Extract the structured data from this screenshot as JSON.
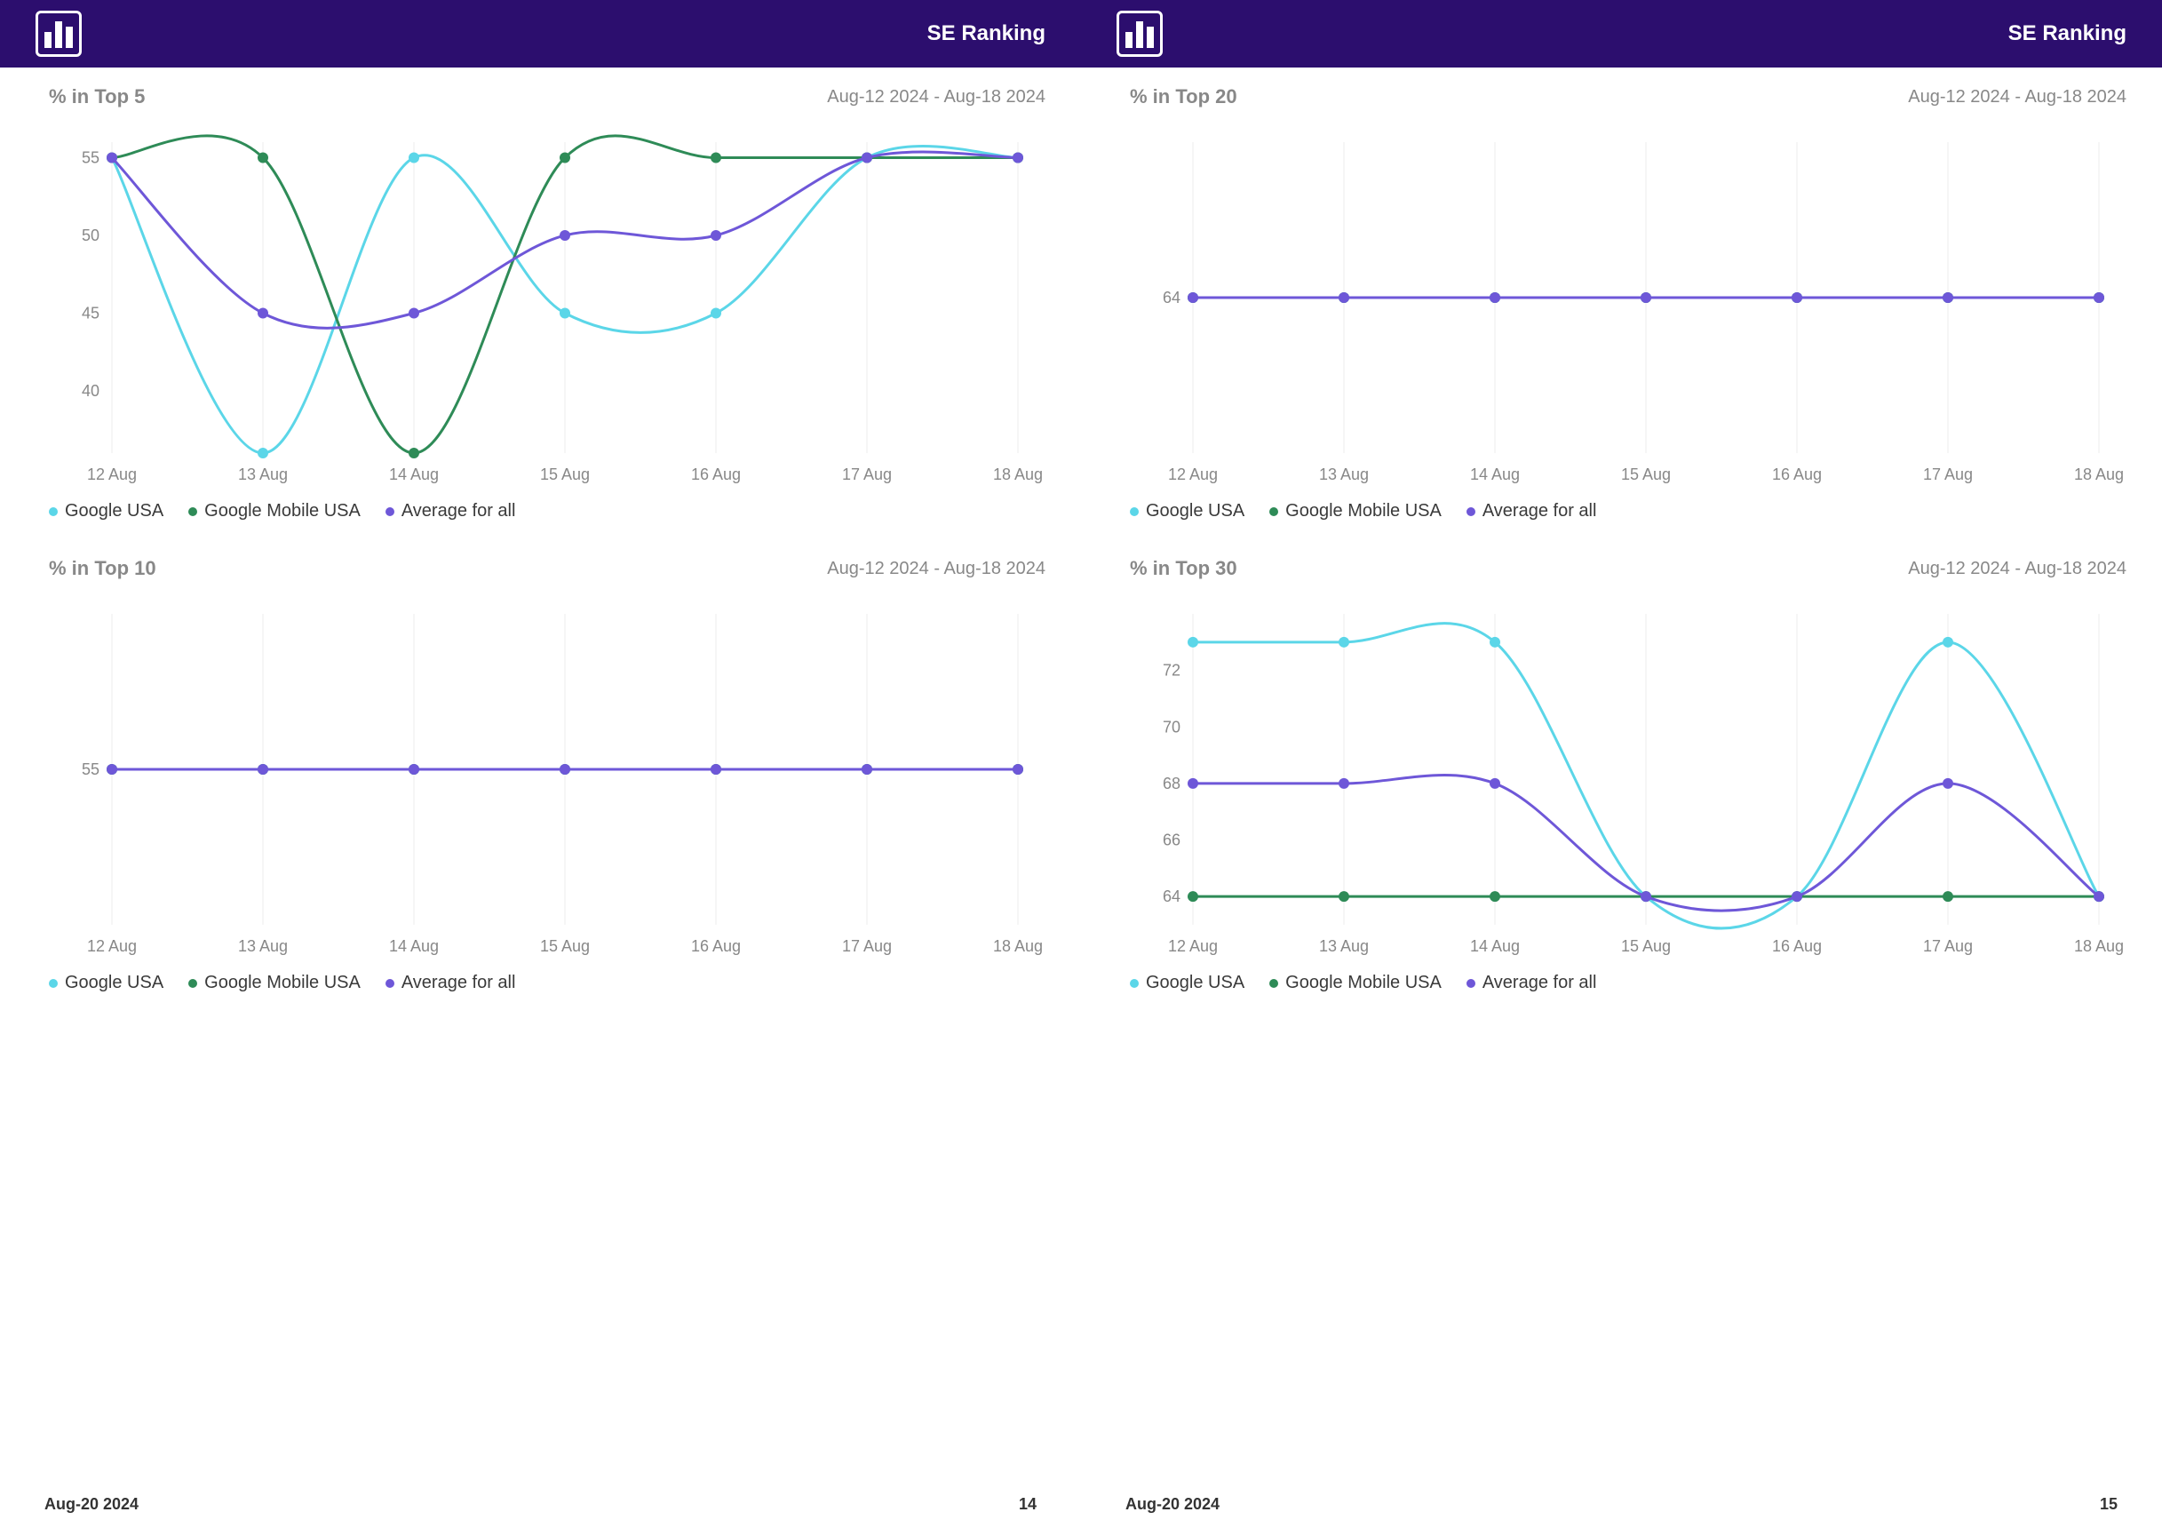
{
  "brand": "SE Ranking",
  "date_range": "Aug-12 2024 - Aug-18 2024",
  "footer_date": "Aug-20 2024",
  "page_left": "14",
  "page_right": "15",
  "categories": [
    "12 Aug",
    "13 Aug",
    "14 Aug",
    "15 Aug",
    "16 Aug",
    "17 Aug",
    "18 Aug"
  ],
  "legends": [
    {
      "name": "Google USA",
      "color": "#5bd6e8"
    },
    {
      "name": "Google Mobile USA",
      "color": "#2e8b57"
    },
    {
      "name": "Average for all",
      "color": "#6e57d8"
    }
  ],
  "chart_data": [
    {
      "id": "top5",
      "title": "% in Top 5",
      "type": "line",
      "ylim": [
        36,
        56
      ],
      "yticks": [
        40,
        45,
        50,
        55
      ],
      "series": [
        {
          "name": "Google USA",
          "color": "#5bd6e8",
          "values": [
            55,
            36,
            55,
            45,
            45,
            55,
            55
          ]
        },
        {
          "name": "Google Mobile USA",
          "color": "#2e8b57",
          "values": [
            55,
            55,
            36,
            55,
            55,
            55,
            55
          ]
        },
        {
          "name": "Average for all",
          "color": "#6e57d8",
          "values": [
            55,
            45,
            45,
            50,
            50,
            55,
            55
          ]
        }
      ]
    },
    {
      "id": "top10",
      "title": "% in Top 10",
      "type": "line",
      "ylim": [
        50,
        60
      ],
      "yticks": [
        55
      ],
      "series": [
        {
          "name": "Google USA",
          "color": "#5bd6e8",
          "values": [
            55,
            55,
            55,
            55,
            55,
            55,
            55
          ]
        },
        {
          "name": "Google Mobile USA",
          "color": "#2e8b57",
          "values": [
            55,
            55,
            55,
            55,
            55,
            55,
            55
          ]
        },
        {
          "name": "Average for all",
          "color": "#6e57d8",
          "values": [
            55,
            55,
            55,
            55,
            55,
            55,
            55
          ]
        }
      ]
    },
    {
      "id": "top20",
      "title": "% in Top 20",
      "type": "line",
      "ylim": [
        60,
        68
      ],
      "yticks": [
        64
      ],
      "series": [
        {
          "name": "Google USA",
          "color": "#5bd6e8",
          "values": [
            64,
            64,
            64,
            64,
            64,
            64,
            64
          ]
        },
        {
          "name": "Google Mobile USA",
          "color": "#2e8b57",
          "values": [
            64,
            64,
            64,
            64,
            64,
            64,
            64
          ]
        },
        {
          "name": "Average for all",
          "color": "#6e57d8",
          "values": [
            64,
            64,
            64,
            64,
            64,
            64,
            64
          ]
        }
      ]
    },
    {
      "id": "top30",
      "title": "% in Top 30",
      "type": "line",
      "ylim": [
        63,
        74
      ],
      "yticks": [
        64,
        66,
        68,
        70,
        72
      ],
      "series": [
        {
          "name": "Google USA",
          "color": "#5bd6e8",
          "values": [
            73,
            73,
            73,
            64,
            64,
            73,
            64
          ]
        },
        {
          "name": "Google Mobile USA",
          "color": "#2e8b57",
          "values": [
            64,
            64,
            64,
            64,
            64,
            64,
            64
          ]
        },
        {
          "name": "Average for all",
          "color": "#6e57d8",
          "values": [
            68,
            68,
            68,
            64,
            64,
            68,
            64
          ]
        }
      ]
    }
  ]
}
